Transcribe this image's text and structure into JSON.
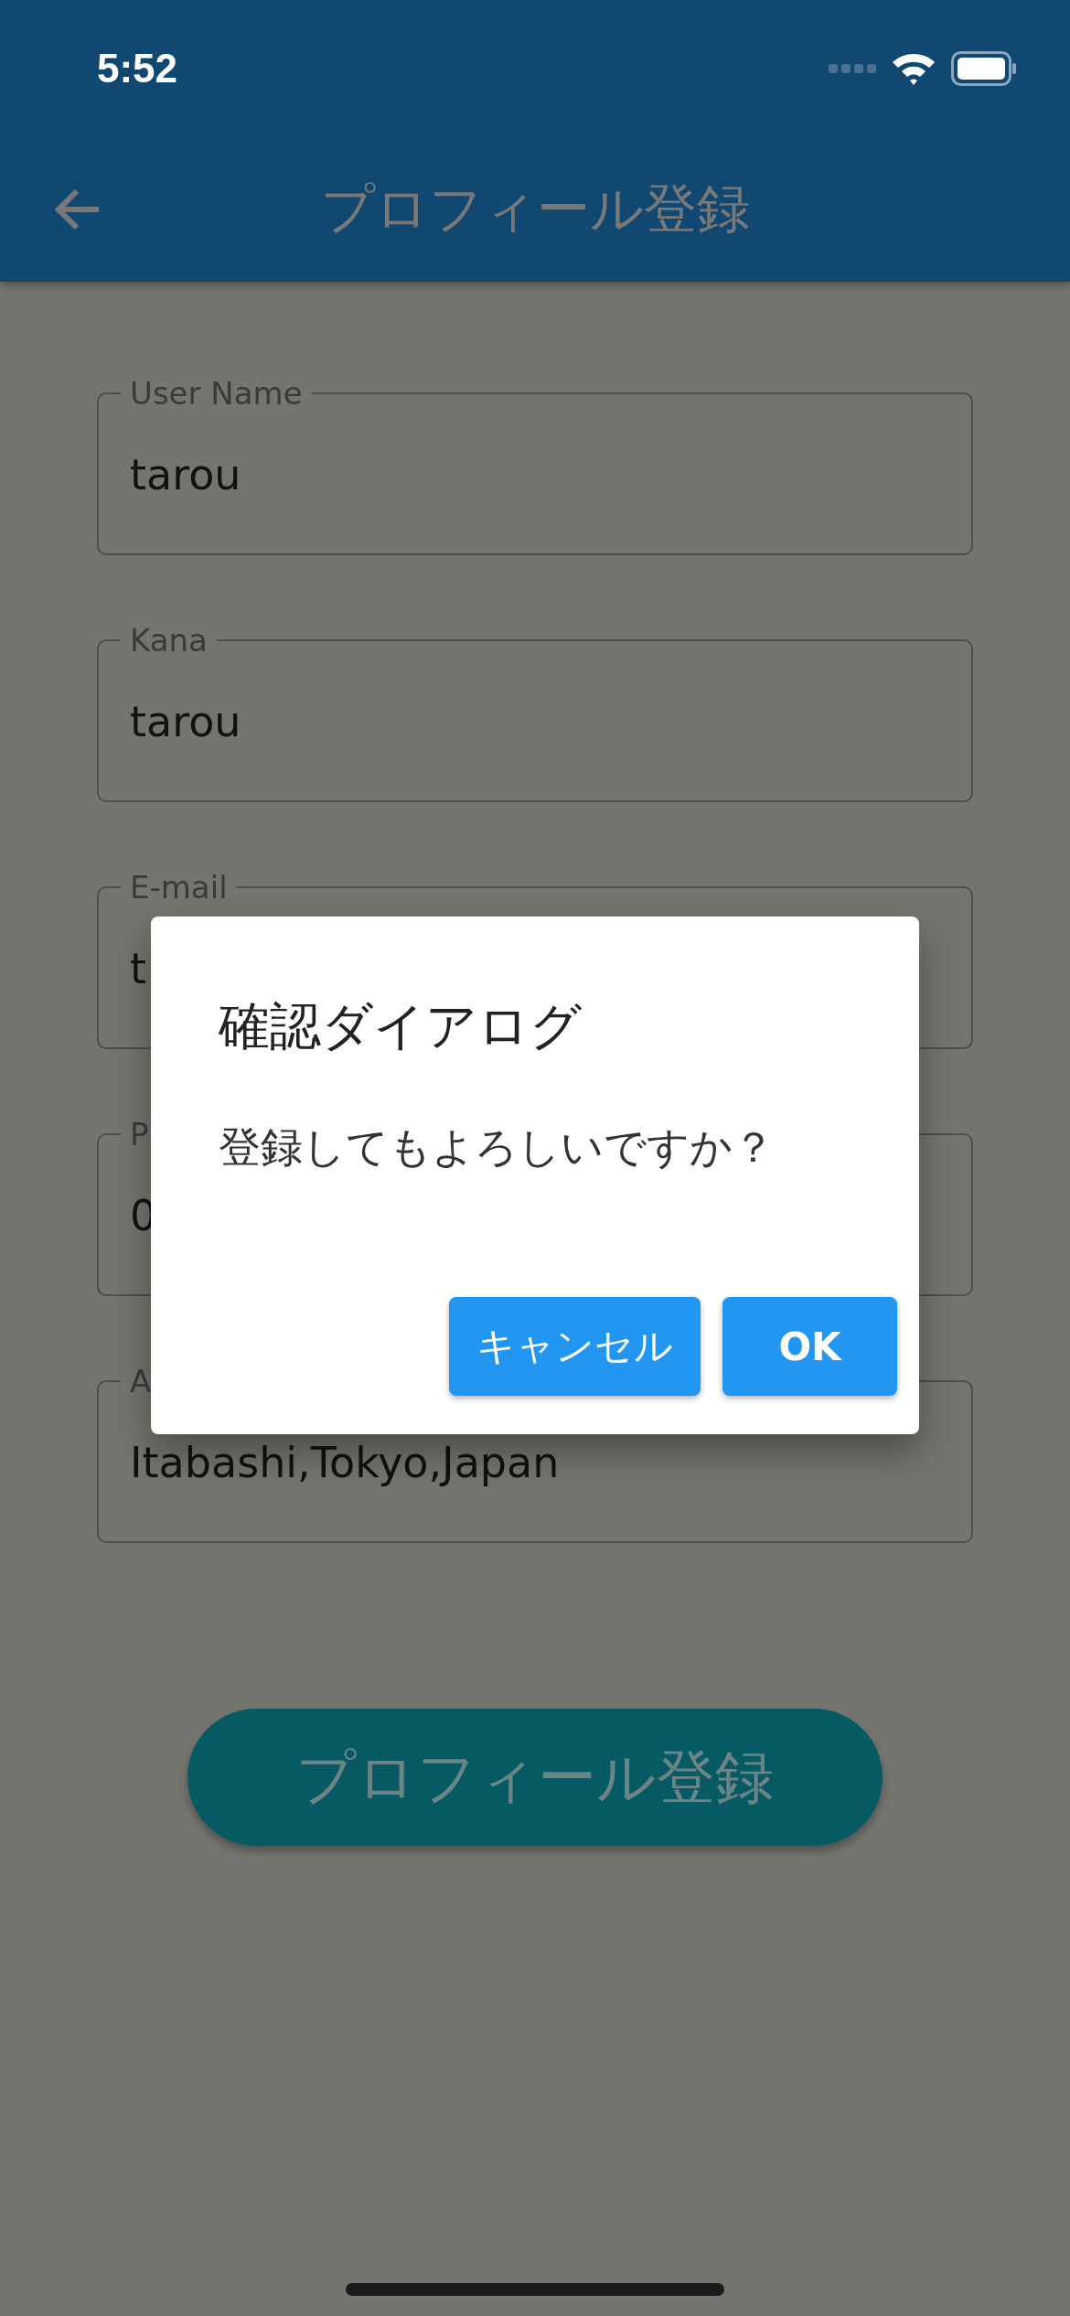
{
  "status_bar": {
    "time": "5:52"
  },
  "app_bar": {
    "title": "プロフィール登録"
  },
  "fields": [
    {
      "label": "User Name",
      "value": "tarou"
    },
    {
      "label": "Kana",
      "value": "tarou"
    },
    {
      "label": "E-mail",
      "value": "t"
    },
    {
      "label": "P",
      "value": "0"
    },
    {
      "label": "A",
      "value": "Itabashi,Tokyo,Japan"
    }
  ],
  "submit_button": {
    "label": "プロフィール登録"
  },
  "dialog": {
    "title": "確認ダイアログ",
    "message": "登録してもよろしいですか？",
    "buttons": [
      {
        "label": "キャンセル"
      },
      {
        "label": "OK"
      }
    ]
  }
}
